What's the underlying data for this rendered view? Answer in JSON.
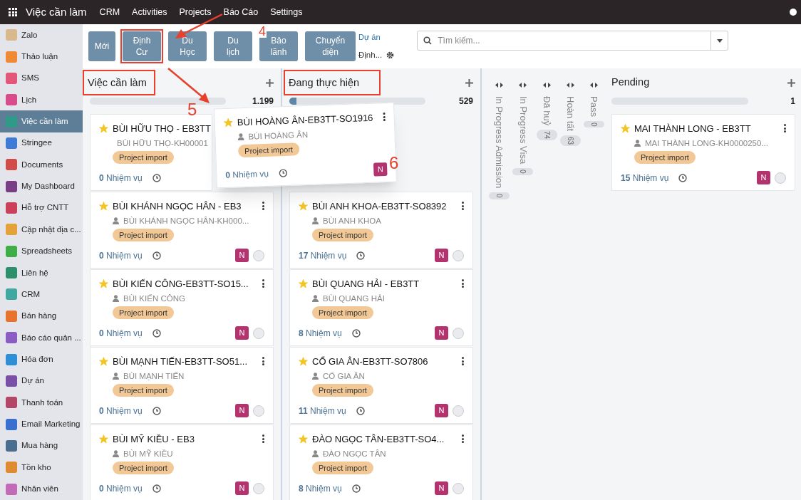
{
  "topbar": {
    "app": "Việc cần làm",
    "menu": [
      "CRM",
      "Activities",
      "Projects",
      "Báo Cáo",
      "Settings"
    ]
  },
  "sidebar": {
    "items": [
      {
        "label": "Zalo",
        "selected": false
      },
      {
        "label": "Thảo luận",
        "selected": false
      },
      {
        "label": "SMS",
        "selected": false
      },
      {
        "label": "Lịch",
        "selected": false
      },
      {
        "label": "Việc cần làm",
        "selected": true
      },
      {
        "label": "Stringee",
        "selected": false
      },
      {
        "label": "Documents",
        "selected": false
      },
      {
        "label": "My Dashboard",
        "selected": false
      },
      {
        "label": "Hỗ trợ CNTT",
        "selected": false
      },
      {
        "label": "Cập nhật địa c...",
        "selected": false
      },
      {
        "label": "Spreadsheets",
        "selected": false
      },
      {
        "label": "Liên hệ",
        "selected": false
      },
      {
        "label": "CRM",
        "selected": false
      },
      {
        "label": "Bán hàng",
        "selected": false
      },
      {
        "label": "Báo cáo quản ...",
        "selected": false
      },
      {
        "label": "Hóa đơn",
        "selected": false
      },
      {
        "label": "Dự án",
        "selected": false
      },
      {
        "label": "Thanh toán",
        "selected": false
      },
      {
        "label": "Email Marketing",
        "selected": false
      },
      {
        "label": "Mua hàng",
        "selected": false
      },
      {
        "label": "Tồn kho",
        "selected": false
      },
      {
        "label": "Nhân viên",
        "selected": false
      }
    ]
  },
  "control_panel": {
    "buttons": [
      {
        "label": "Mới",
        "highlighted": false
      },
      {
        "label": "Định Cư",
        "highlighted": true
      },
      {
        "label": "Du Học",
        "highlighted": false
      },
      {
        "label": "Du lịch",
        "highlighted": false
      },
      {
        "label": "Bảo lãnh",
        "highlighted": false
      },
      {
        "label": "Chuyển diện",
        "highlighted": false
      }
    ],
    "link": "Dự án",
    "filter": "Định...",
    "search": {
      "placeholder": "Tìm kiếm..."
    }
  },
  "columns": [
    {
      "title": "Việc cần làm",
      "highlighted": true,
      "level": 0,
      "count": "1.199",
      "cards": [
        {
          "title": "BÙI HỮU THỌ - EB3TT",
          "customer": "BÙI HỮU THỌ-KH00001",
          "tag": "Project import",
          "tasks": "0",
          "tasks_label": "Nhiệm vụ",
          "starred": true
        },
        {
          "title": "BÙI KHÁNH NGỌC HÂN - EB3",
          "customer": "BÙI KHÁNH NGỌC HÂN-KH000...",
          "tag": "Project import",
          "tasks": "0",
          "tasks_label": "Nhiệm vụ",
          "starred": true,
          "assignee": "N"
        },
        {
          "title": "BÙI KIẾN CÔNG-EB3TT-SO15...",
          "customer": "BÙI KIẾN CÔNG",
          "tag": "Project import",
          "tasks": "0",
          "tasks_label": "Nhiệm vụ",
          "starred": true,
          "assignee": "N"
        },
        {
          "title": "BÙI MẠNH TIẾN-EB3TT-SO51...",
          "customer": "BÙI MẠNH TIẾN",
          "tag": "Project import",
          "tasks": "0",
          "tasks_label": "Nhiệm vụ",
          "starred": true,
          "assignee": "N"
        },
        {
          "title": "BÙI MỸ KIỀU - EB3",
          "customer": "BÙI MỸ KIỀU",
          "tag": "Project import",
          "tasks": "0",
          "tasks_label": "Nhiệm vụ",
          "starred": true,
          "assignee": "N"
        }
      ]
    },
    {
      "title": "Đang thực hiện",
      "highlighted": true,
      "level": 0.05,
      "count": "529",
      "cards": [
        {
          "title": "BÙI ANH KHOA-EB3TT-SO8392",
          "customer": "BÙI ANH KHOA",
          "tag": "Project import",
          "tasks": "17",
          "tasks_label": "Nhiệm vụ",
          "starred": true,
          "assignee": "N"
        },
        {
          "title": "BÙI QUANG HẢI - EB3TT",
          "customer": "BÙI QUANG HẢI",
          "tag": "Project import",
          "tasks": "8",
          "tasks_label": "Nhiệm vụ",
          "starred": true,
          "assignee": "N"
        },
        {
          "title": "CỔ GIA ÂN-EB3TT-SO7806",
          "customer": "CỔ GIA ÂN",
          "tag": "Project import",
          "tasks": "11",
          "tasks_label": "Nhiệm vụ",
          "starred": true,
          "assignee": "N"
        },
        {
          "title": "ĐÀO NGỌC TÂN-EB3TT-SO4...",
          "customer": "ĐÀO NGỌC TÂN",
          "tag": "Project import",
          "tasks": "8",
          "tasks_label": "Nhiệm vụ",
          "starred": true,
          "assignee": "N"
        }
      ]
    }
  ],
  "folded_columns": [
    {
      "title": "In Progress Admission",
      "count": "0"
    },
    {
      "title": "In Progress Visa",
      "count": "0"
    },
    {
      "title": "Đã huỷ",
      "count": "74"
    },
    {
      "title": "Hoàn tất",
      "count": "63"
    },
    {
      "title": "Pass",
      "count": "0"
    }
  ],
  "pending_column": {
    "title": "Pending",
    "level": 0,
    "count": "1",
    "cards": [
      {
        "title": "MAI THÀNH LONG - EB3TT",
        "customer": "MAI THÀNH LONG-KH0000250...",
        "tag": "Project import",
        "tasks": "15",
        "tasks_label": "Nhiệm vụ",
        "starred": true,
        "assignee": "N"
      }
    ]
  },
  "dragged_card": {
    "title": "BÙI HOÀNG ÂN-EB3TT-SO1916",
    "customer": "BÙI HOÀNG ÂN",
    "tag": "Project import",
    "tasks": "0",
    "tasks_label": "Nhiệm vụ",
    "starred": true,
    "assignee": "N"
  },
  "annotations": [
    {
      "label": "4"
    },
    {
      "label": "5"
    },
    {
      "label": "6"
    }
  ]
}
